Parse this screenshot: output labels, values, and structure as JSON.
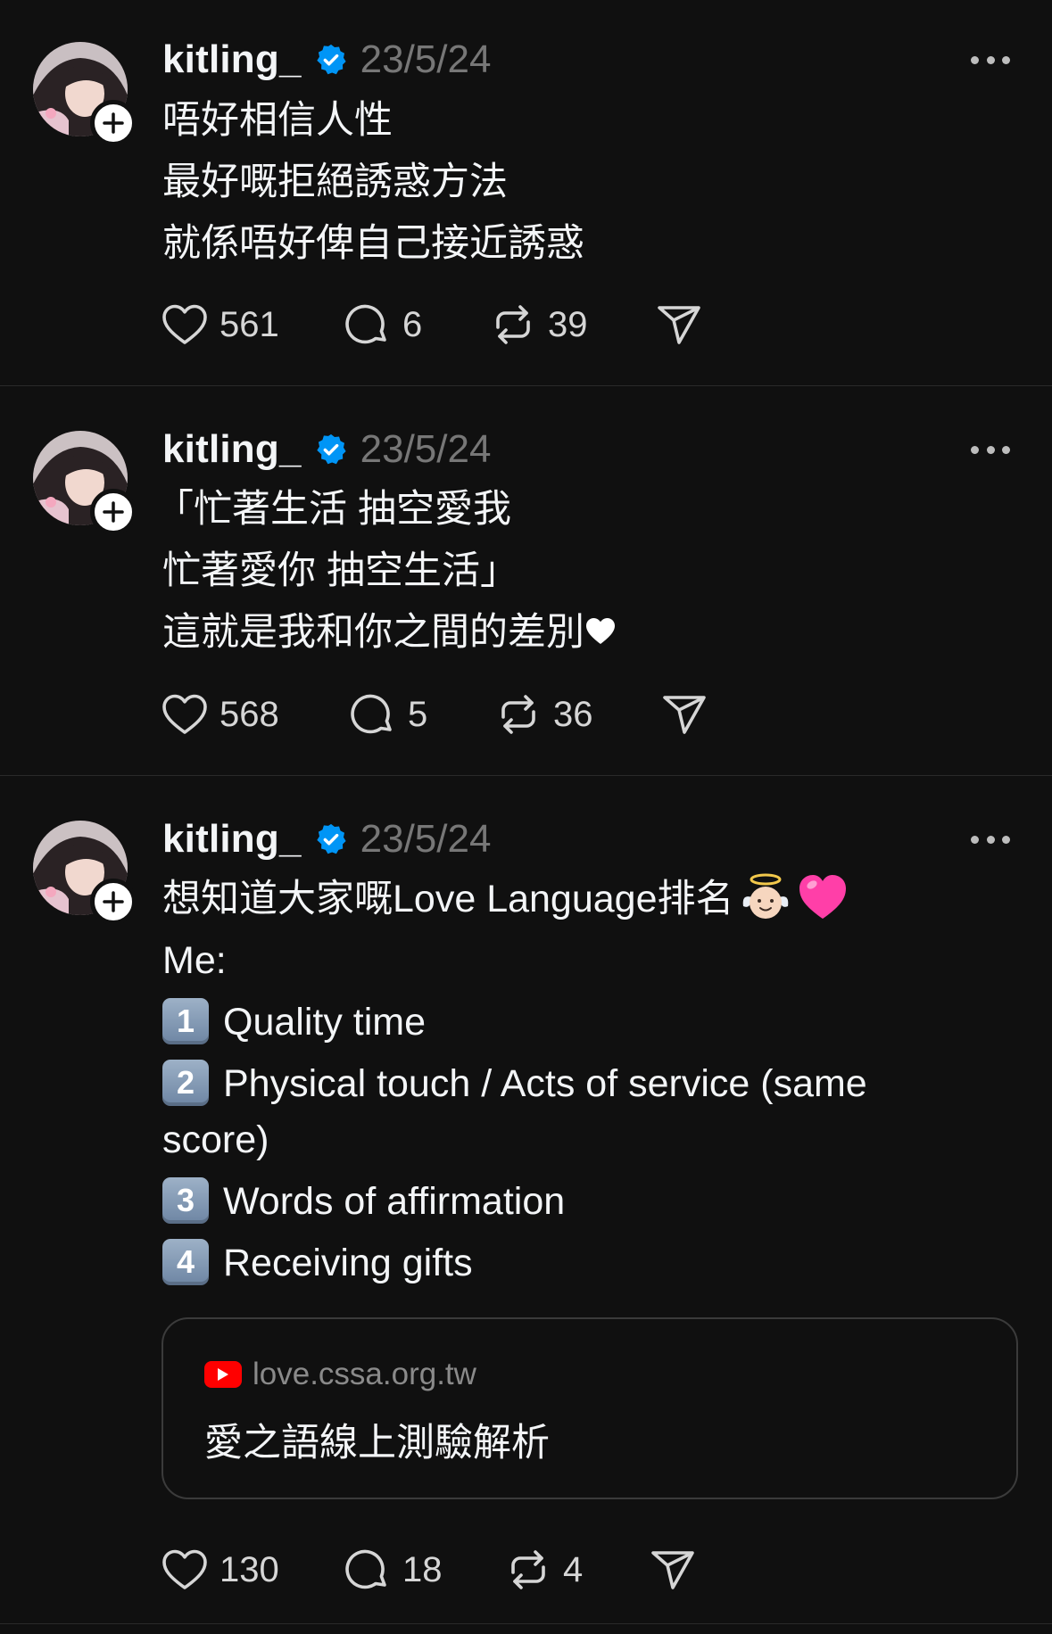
{
  "posts": [
    {
      "username": "kitling_",
      "date": "23/5/24",
      "lines": [
        "唔好相信人性",
        "最好嘅拒絕誘惑方法",
        "就係唔好俾自己接近誘惑"
      ],
      "likes": "561",
      "replies": "6",
      "reposts": "39"
    },
    {
      "username": "kitling_",
      "date": "23/5/24",
      "lines": [
        "「忙著生活 抽空愛我",
        "忙著愛你 抽空生活」",
        "這就是我和你之間的差別"
      ],
      "likes": "568",
      "replies": "5",
      "reposts": "36"
    },
    {
      "username": "kitling_",
      "date": "23/5/24",
      "line1": "想知道大家嘅Love Language排名",
      "line2": "Me:",
      "items": [
        {
          "num": "1",
          "text": "Quality time"
        },
        {
          "num": "2",
          "text": "Physical touch / Acts of service (same score)"
        },
        {
          "num": "3",
          "text": "Words of affirmation"
        },
        {
          "num": "4",
          "text": "Receiving gifts"
        }
      ],
      "card": {
        "domain": "love.cssa.org.tw",
        "title": "愛之語線上測驗解析"
      },
      "likes": "130",
      "replies": "18",
      "reposts": "4"
    }
  ],
  "colors": {
    "background": "#101010",
    "verified": "#0095f6",
    "text": "#f3f5f7",
    "muted": "#777777"
  },
  "icons": [
    "follow-plus-icon",
    "verified-badge-icon",
    "more-options-icon",
    "heart-icon",
    "reply-icon",
    "repost-icon",
    "share-icon",
    "youtube-icon",
    "angel-emoji-icon",
    "pink-heart-emoji-icon",
    "white-heart-emoji-icon"
  ]
}
